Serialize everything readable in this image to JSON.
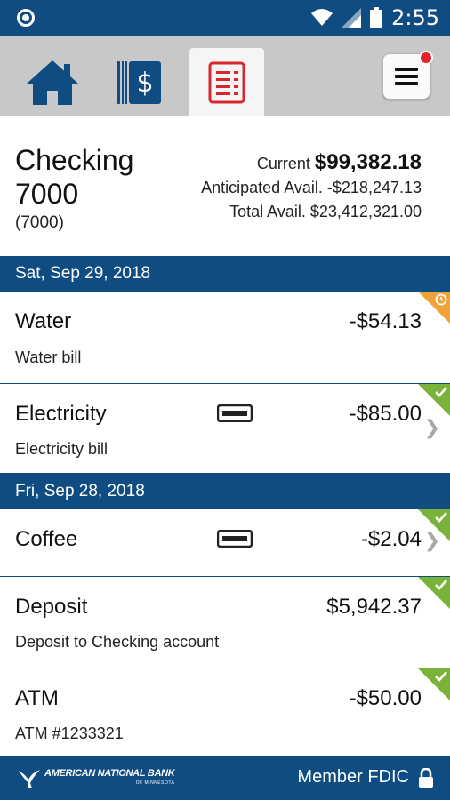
{
  "status_bar": {
    "time": "2:55"
  },
  "tabs": [
    {
      "name": "Home"
    },
    {
      "name": "Accounts"
    },
    {
      "name": "Register"
    }
  ],
  "account": {
    "name": "Checking 7000",
    "number": "(7000)",
    "current_label": "Current",
    "current_value": "$99,382.18",
    "anticipated_label": "Anticipated Avail.",
    "anticipated_value": "-$218,247.13",
    "total_label": "Total Avail.",
    "total_value": "$23,412,321.00"
  },
  "groups": [
    {
      "date": "Sat, Sep 29, 2018",
      "transactions": [
        {
          "name": "Water",
          "description": "Water bill",
          "amount": "-$54.13",
          "status": "pending"
        },
        {
          "name": "Electricity",
          "description": "Electricity bill",
          "amount": "-$85.00",
          "status": "cleared"
        }
      ]
    },
    {
      "date": "Fri, Sep 28, 2018",
      "transactions": [
        {
          "name": "Coffee",
          "description": "",
          "amount": "-$2.04",
          "status": "cleared"
        },
        {
          "name": "Deposit",
          "description": "Deposit to Checking account",
          "amount": "$5,942.37",
          "status": "cleared"
        },
        {
          "name": "ATM",
          "description": "ATM #1233321",
          "amount": "-$50.00",
          "status": "cleared"
        }
      ]
    }
  ],
  "footer": {
    "bank_name": "AMERICAN NATIONAL BANK",
    "bank_sub": "OF MINNESOTA",
    "member_text": "Member FDIC"
  },
  "colors": {
    "brand": "#0f4c81",
    "cleared": "#7bb33a",
    "pending": "#f0a23a",
    "alert": "#e4232b"
  }
}
